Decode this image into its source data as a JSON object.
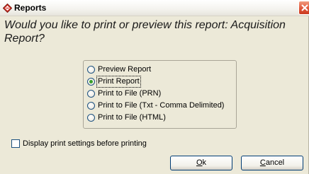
{
  "window": {
    "title": "Reports",
    "app_icon": "reports-diamond-icon",
    "close_icon": "close-icon"
  },
  "prompt": {
    "question": "Would you like to print or preview this report:  Acquisition Report?"
  },
  "output_options": {
    "items": [
      {
        "label": "Preview Report",
        "selected": false
      },
      {
        "label": "Print Report",
        "selected": true
      },
      {
        "label": "Print to File (PRN)",
        "selected": false
      },
      {
        "label": "Print to File (Txt - Comma Delimited)",
        "selected": false
      },
      {
        "label": "Print to File (HTML)",
        "selected": false
      }
    ]
  },
  "settings": {
    "display_print_settings_label": "Display print settings before printing",
    "display_print_settings_checked": false
  },
  "buttons": {
    "ok_label": "Ok",
    "cancel_label": "Cancel"
  },
  "colors": {
    "dialog_background": "#ece9d8",
    "close_button": "#e0573a",
    "radio_selected_dot": "#3a9f2c",
    "control_border": "#1c5180"
  }
}
